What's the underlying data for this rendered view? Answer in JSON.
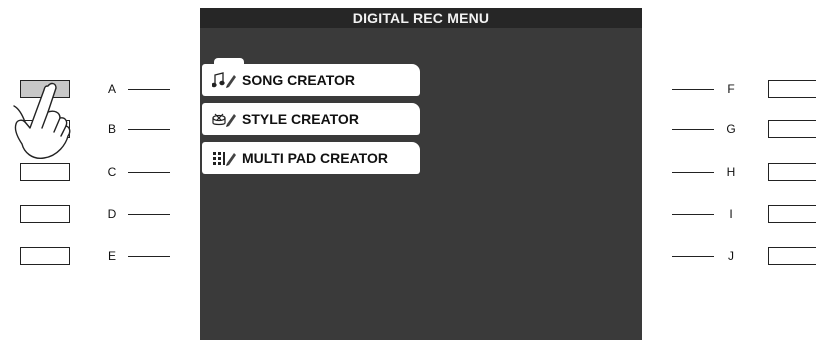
{
  "screen": {
    "title": "DIGITAL REC MENU",
    "items": [
      {
        "label": "SONG CREATOR",
        "icon": "note-pencil-icon"
      },
      {
        "label": "STYLE CREATOR",
        "icon": "drum-pencil-icon"
      },
      {
        "label": "MULTI PAD CREATOR",
        "icon": "pads-pencil-icon"
      }
    ]
  },
  "left_buttons": [
    "A",
    "B",
    "C",
    "D",
    "E"
  ],
  "right_buttons": [
    "F",
    "G",
    "H",
    "I",
    "J"
  ],
  "pressed_button": "A",
  "colors": {
    "screen_bg": "#3a3a3a",
    "title_bar": "#262626",
    "menu_item_bg": "#ffffff",
    "pressed_button": "#c8c8c8"
  }
}
